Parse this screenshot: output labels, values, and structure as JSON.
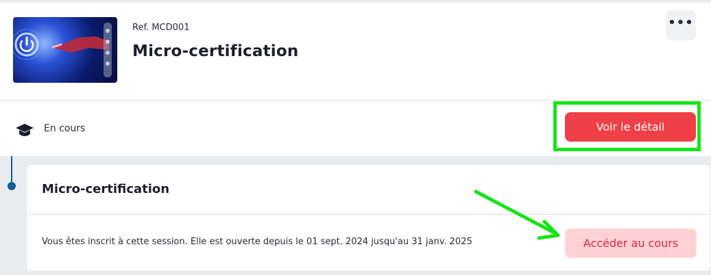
{
  "course": {
    "ref": "Ref. MCD001",
    "title": "Micro-certification",
    "status": "En cours",
    "detail_button": "Voir le détail",
    "more_icon": "more-horizontal-icon"
  },
  "session": {
    "title": "Micro-certification",
    "description": "Vous êtes inscrit à cette session. Elle est ouverte depuis le 01 sept. 2024 jusqu'au 31 janv. 2025",
    "access_button": "Accéder au cours"
  },
  "colors": {
    "primary_button": "#ef3f47",
    "secondary_button_bg": "#ffd2d6",
    "secondary_button_text": "#d6283a",
    "annotation": "#16e416",
    "timeline": "#0f5e93"
  }
}
